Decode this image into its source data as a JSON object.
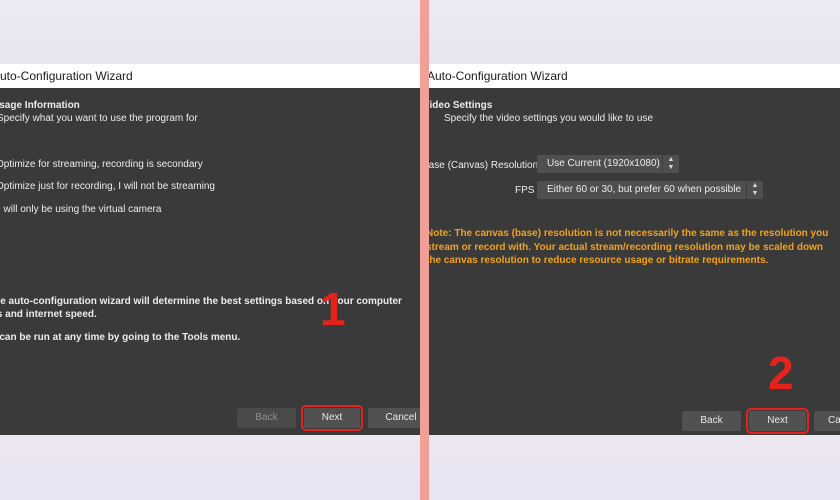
{
  "left": {
    "window_title": "Auto-Configuration Wizard",
    "heading": "Usage Information",
    "subheading": "Specify what you want to use the program for",
    "options": [
      "Optimize for streaming, recording is secondary",
      "Optimize just for recording, I will not be streaming",
      "I will only be using the virtual camera"
    ],
    "info_line1": "The auto-configuration wizard will determine the best settings based on your computer",
    "info_line2": "specs and internet speed.",
    "info_line3": "This can be run at any time by going to the Tools menu.",
    "buttons": {
      "back": "Back",
      "next": "Next",
      "cancel": "Cancel"
    },
    "step_label": "1"
  },
  "right": {
    "window_title": "Auto-Configuration Wizard",
    "heading": "Video Settings",
    "subheading": "Specify the video settings you would like to use",
    "resolution_label": "Base (Canvas) Resolution",
    "resolution_value": "Use Current (1920x1080)",
    "fps_label": "FPS",
    "fps_value": "Either 60 or 30, but prefer 60 when possible",
    "note_line1": "Note: The canvas (base) resolution is not necessarily the same as the resolution you",
    "note_line2": "stream or record with. Your actual stream/recording resolution may be scaled down",
    "note_line3": "the canvas resolution to reduce resource usage or bitrate requirements.",
    "buttons": {
      "back": "Back",
      "next": "Next",
      "cancel": "Cancel"
    },
    "step_label": "2"
  },
  "colors": {
    "accent_red": "#e5221b",
    "warning_orange": "#f0a21c",
    "dialog_bg": "#3a3a3a"
  }
}
